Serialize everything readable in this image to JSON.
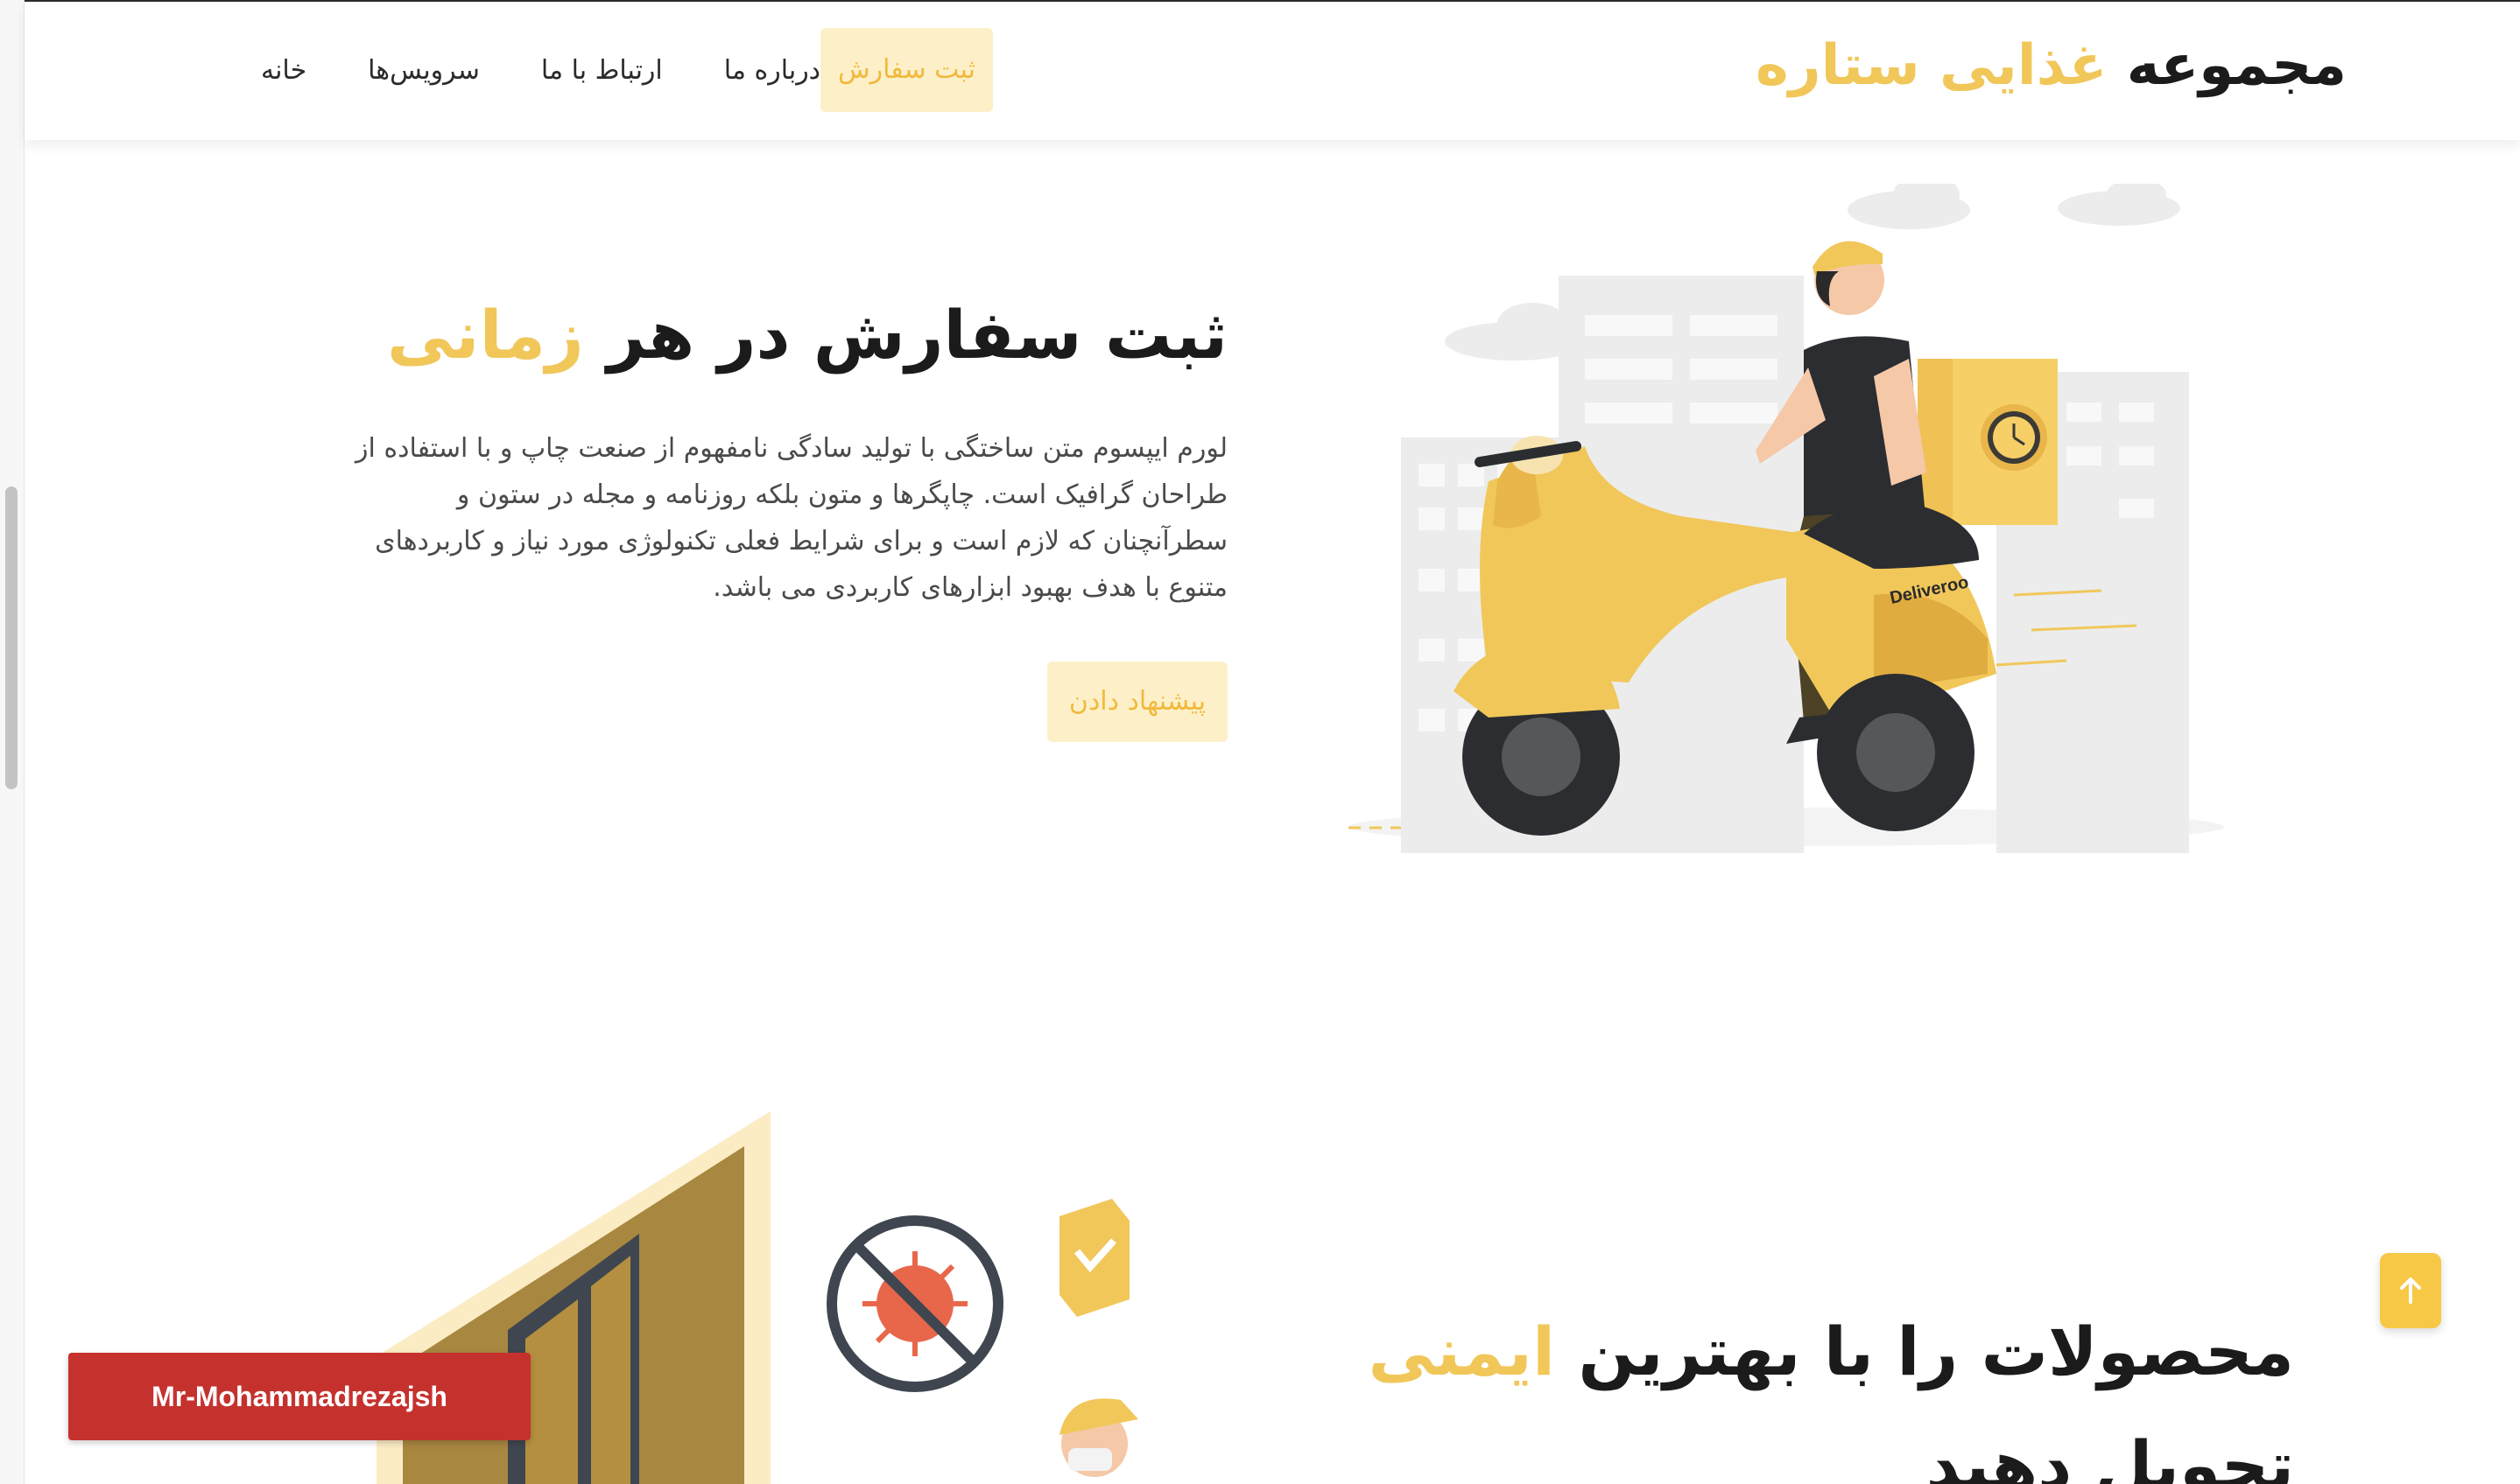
{
  "header": {
    "brand_main": "مجموعه",
    "brand_accent": "غذایی ستاره",
    "nav": {
      "home": "خانه",
      "services": "سرویس‌ها",
      "contact": "ارتباط با ما",
      "about": "درباره ما",
      "order_cta": "ثبت سفارش"
    }
  },
  "hero": {
    "title_main": "ثبت سفارش در هر",
    "title_accent": "زمانی",
    "paragraph": "لورم ایپسوم متن ساختگی با تولید سادگی نامفهوم از صنعت چاپ و با استفاده از طراحان گرافیک است. چاپگرها و متون بلکه روزنامه و مجله در ستون و سطرآنچنان که لازم است و برای شرایط فعلی تکنولوژی مورد نیاز و کاربردهای متنوع با هدف بهبود ابزارهای کاربردی می باشد.",
    "button": "پیشنهاد دادن",
    "scooter_brand": "Deliveroo"
  },
  "section_delivery": {
    "title_part1": "محصولات را با بهترین",
    "title_accent": "ایمنی",
    "title_part2": "تحویل دهید"
  },
  "floating": {
    "author": "Mr-Mohammadrezajsh",
    "back_to_top_icon": "arrow-up-icon"
  },
  "colors": {
    "accent": "#f1c75a",
    "accent_soft": "#fdf0c9",
    "badge_red": "#c5322e"
  }
}
